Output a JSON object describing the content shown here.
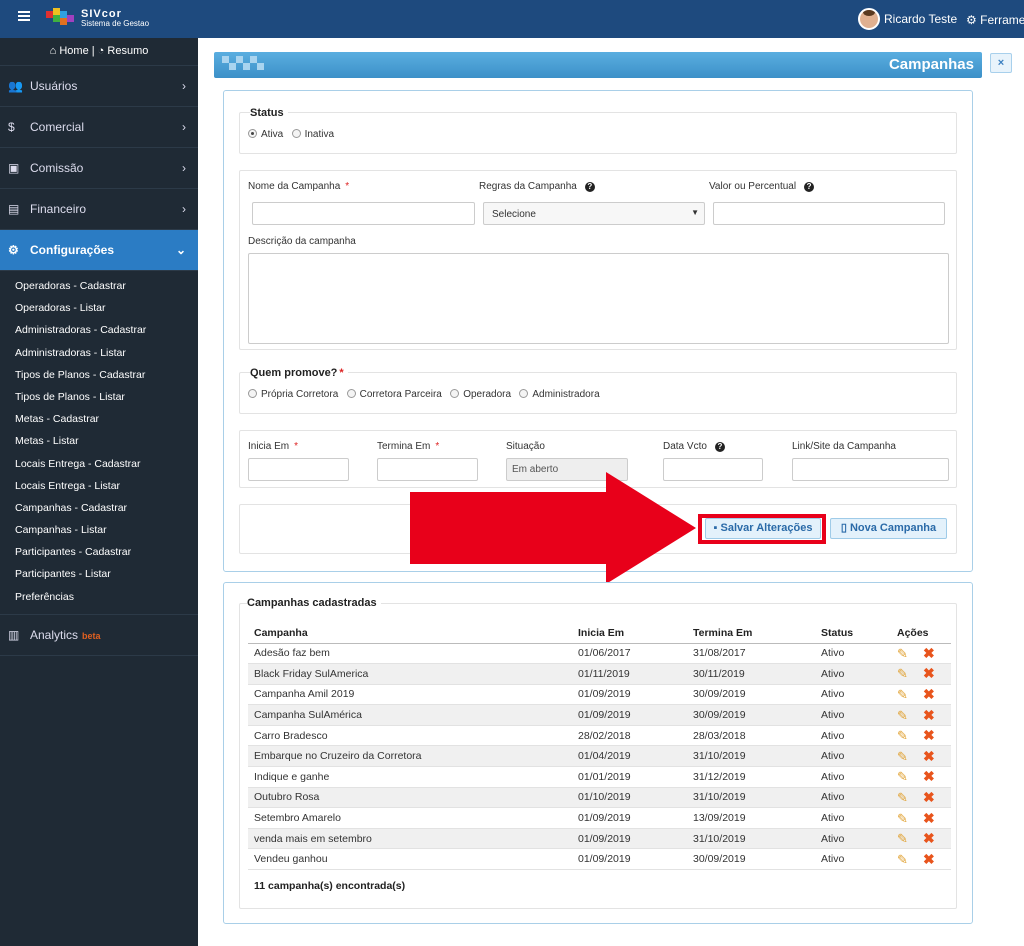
{
  "topbar": {
    "brand": "SIVcor",
    "brand_sub": "Sistema de Gestao",
    "user_name": "Ricardo Teste",
    "tools_label": "Ferramentas"
  },
  "sidebar": {
    "home_label": "Home",
    "resumo_label": "Resumo",
    "items": [
      {
        "label": "Usuários",
        "icon": "users-icon"
      },
      {
        "label": "Comercial",
        "icon": "dollar-icon"
      },
      {
        "label": "Comissão",
        "icon": "money-icon"
      },
      {
        "label": "Financeiro",
        "icon": "briefcase-icon"
      },
      {
        "label": "Configurações",
        "icon": "gears-icon"
      }
    ],
    "submenu": [
      "Operadoras - Cadastrar",
      "Operadoras - Listar",
      "Administradoras - Cadastrar",
      "Administradoras - Listar",
      "Tipos de Planos - Cadastrar",
      "Tipos de Planos - Listar",
      "Metas - Cadastrar",
      "Metas - Listar",
      "Locais Entrega - Cadastrar",
      "Locais Entrega - Listar",
      "Campanhas - Cadastrar",
      "Campanhas - Listar",
      "Participantes - Cadastrar",
      "Participantes - Listar",
      "Preferências"
    ],
    "analytics_label": "Analytics",
    "beta_label": "beta"
  },
  "page": {
    "title": "Campanhas",
    "close_label": "×"
  },
  "form": {
    "status_title": "Status",
    "status_options": [
      "Ativa",
      "Inativa"
    ],
    "nome_label": "Nome da Campanha",
    "regras_label": "Regras da Campanha",
    "regras_value": "Selecione",
    "valor_label": "Valor ou Percentual",
    "descricao_label": "Descrição da campanha",
    "promove_title": "Quem promove?",
    "promove_options": [
      "Própria Corretora",
      "Corretora Parceira",
      "Operadora",
      "Administradora"
    ],
    "inicia_label": "Inicia Em",
    "termina_label": "Termina Em",
    "situacao_label": "Situação",
    "situacao_value": "Em aberto",
    "data_vcto_label": "Data Vcto",
    "link_label": "Link/Site da Campanha",
    "save_label": "Salvar Alterações",
    "new_label": "Nova Campanha"
  },
  "list": {
    "title": "Campanhas cadastradas",
    "columns": [
      "Campanha",
      "Inicia Em",
      "Termina Em",
      "Status",
      "Ações"
    ],
    "rows": [
      [
        "Adesão faz bem",
        "01/06/2017",
        "31/08/2017",
        "Ativo"
      ],
      [
        "Black Friday SulAmerica",
        "01/11/2019",
        "30/11/2019",
        "Ativo"
      ],
      [
        "Campanha Amil 2019",
        "01/09/2019",
        "30/09/2019",
        "Ativo"
      ],
      [
        "Campanha SulAmérica",
        "01/09/2019",
        "30/09/2019",
        "Ativo"
      ],
      [
        "Carro Bradesco",
        "28/02/2018",
        "28/03/2018",
        "Ativo"
      ],
      [
        "Embarque no Cruzeiro da Corretora",
        "01/04/2019",
        "31/10/2019",
        "Ativo"
      ],
      [
        "Indique e ganhe",
        "01/01/2019",
        "31/12/2019",
        "Ativo"
      ],
      [
        "Outubro Rosa",
        "01/10/2019",
        "31/10/2019",
        "Ativo"
      ],
      [
        "Setembro Amarelo",
        "01/09/2019",
        "13/09/2019",
        "Ativo"
      ],
      [
        "venda mais em setembro",
        "01/09/2019",
        "31/10/2019",
        "Ativo"
      ],
      [
        "Vendeu ganhou",
        "01/09/2019",
        "30/09/2019",
        "Ativo"
      ]
    ],
    "footer": "11 campanha(s) encontrada(s)"
  },
  "colors": {
    "accent": "#2b7cc4",
    "sidebar": "#1f2a35",
    "topbar": "#1e4a7e",
    "highlight": "#e8001a",
    "arrow": "#e8001a"
  }
}
